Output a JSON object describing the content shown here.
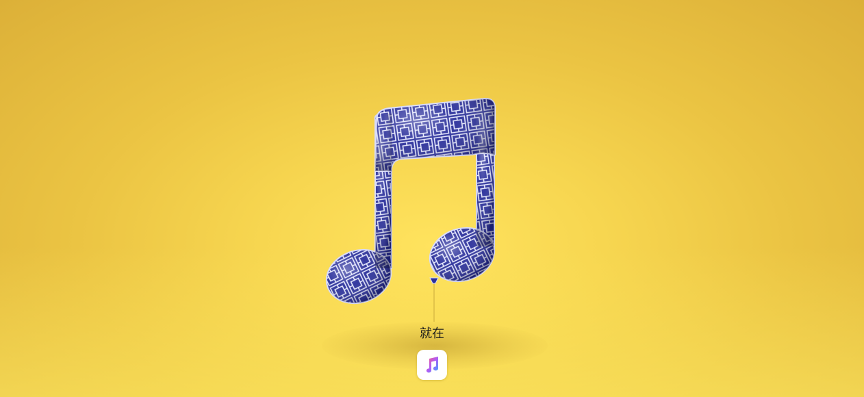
{
  "caption": "就在",
  "icons": {
    "balloon": "music-note-balloon-icon",
    "app": "apple-music-app-icon"
  },
  "colors": {
    "background": "#f2cf48",
    "balloon": "#2a2f9b",
    "pattern": "#e9ecff"
  }
}
